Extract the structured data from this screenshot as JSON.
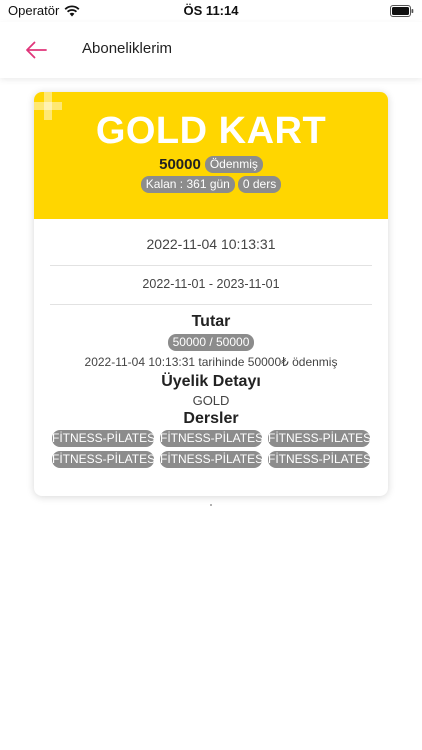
{
  "status_bar": {
    "carrier": "Operatör",
    "time": "ÖS 11:14"
  },
  "header": {
    "title": "Aboneliklerim"
  },
  "card": {
    "title": "GOLD KART",
    "amount": "50000",
    "payment_status": "Ödenmiş",
    "remaining": "Kalan : 361 gün",
    "lessons": "0 ders",
    "purchase_datetime": "2022-11-04 10:13:31",
    "validity_range": "2022-11-01 - 2023-11-01",
    "tutar_title": "Tutar",
    "paid_amount": "50000 / 50000",
    "payment_note": "2022-11-04 10:13:31 tarihinde 50000₺ ödenmiş",
    "membership_title": "Üyelik Detayı",
    "membership_value": "GOLD",
    "courses_title": "Dersler",
    "courses": [
      "FİTNESS-PİLATES",
      "FİTNESS-PİLATES",
      "FİTNESS-PİLATES",
      "FİTNESS-PİLATES",
      "FİTNESS-PİLATES",
      "FİTNESS-PİLATES"
    ]
  },
  "colors": {
    "header_yellow": "#FFD600",
    "back_arrow": "#E0357A",
    "chip_gray": "#8C8C8C"
  },
  "icons": {
    "back": "arrow-left-icon",
    "wifi": "wifi-icon",
    "battery": "battery-icon",
    "decoration": "plus-icon"
  }
}
